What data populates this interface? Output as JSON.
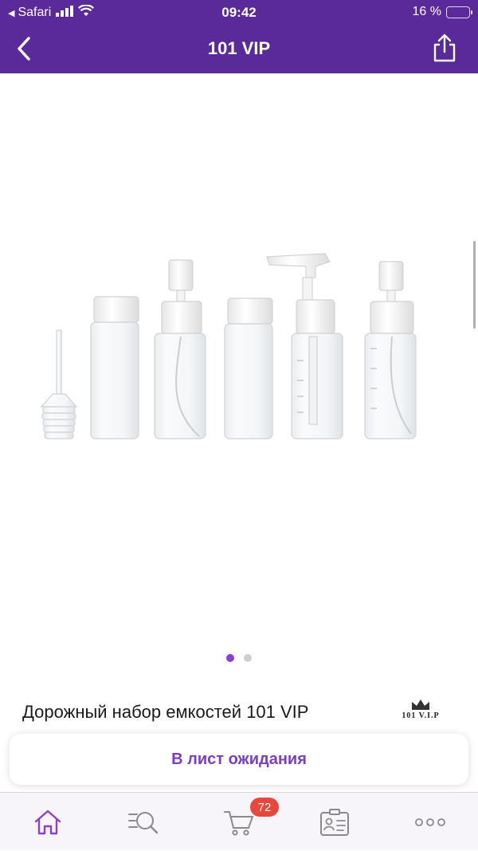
{
  "status_bar": {
    "back_app": "Safari",
    "time": "09:42",
    "battery_percent": "16 %",
    "battery_level": 0.16
  },
  "nav": {
    "title": "101 VIP"
  },
  "gallery": {
    "image_count": 2,
    "active_index": 0
  },
  "product": {
    "title": "Дорожный набор емкостей 101 VIP",
    "brand_logo_text": "101 V.I.P"
  },
  "action": {
    "label": "В лист ожидания"
  },
  "tab_bar": {
    "tabs": [
      {
        "icon": "home-icon",
        "active": true
      },
      {
        "icon": "search-icon",
        "active": false
      },
      {
        "icon": "cart-icon",
        "active": false
      },
      {
        "icon": "profile-card-icon",
        "active": false
      },
      {
        "icon": "more-icon",
        "active": false
      }
    ],
    "cart_count": "72"
  },
  "colors": {
    "brand_purple": "#5b2a9a",
    "accent_purple": "#7d3cc4",
    "badge_red": "#e8473e"
  }
}
